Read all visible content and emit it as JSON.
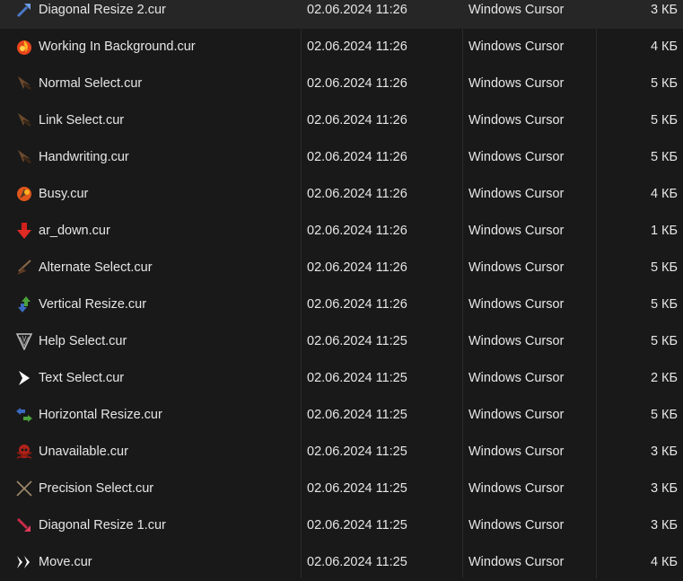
{
  "files": [
    {
      "name": "Diagonal Resize 2.cur",
      "date": "02.06.2024 11:26",
      "type": "Windows Cursor",
      "size": "3 КБ",
      "icon": "diagonal-resize-2-icon"
    },
    {
      "name": "Working In Background.cur",
      "date": "02.06.2024 11:26",
      "type": "Windows Cursor",
      "size": "4 КБ",
      "icon": "working-in-background-icon"
    },
    {
      "name": "Normal Select.cur",
      "date": "02.06.2024 11:26",
      "type": "Windows Cursor",
      "size": "5 КБ",
      "icon": "normal-select-icon"
    },
    {
      "name": "Link Select.cur",
      "date": "02.06.2024 11:26",
      "type": "Windows Cursor",
      "size": "5 КБ",
      "icon": "link-select-icon"
    },
    {
      "name": "Handwriting.cur",
      "date": "02.06.2024 11:26",
      "type": "Windows Cursor",
      "size": "5 КБ",
      "icon": "handwriting-icon"
    },
    {
      "name": "Busy.cur",
      "date": "02.06.2024 11:26",
      "type": "Windows Cursor",
      "size": "4 КБ",
      "icon": "busy-icon"
    },
    {
      "name": "ar_down.cur",
      "date": "02.06.2024 11:26",
      "type": "Windows Cursor",
      "size": "1 КБ",
      "icon": "arrow-down-icon"
    },
    {
      "name": "Alternate Select.cur",
      "date": "02.06.2024 11:26",
      "type": "Windows Cursor",
      "size": "5 КБ",
      "icon": "alternate-select-icon"
    },
    {
      "name": "Vertical Resize.cur",
      "date": "02.06.2024 11:26",
      "type": "Windows Cursor",
      "size": "5 КБ",
      "icon": "vertical-resize-icon"
    },
    {
      "name": "Help Select.cur",
      "date": "02.06.2024 11:25",
      "type": "Windows Cursor",
      "size": "5 КБ",
      "icon": "help-select-icon"
    },
    {
      "name": "Text Select.cur",
      "date": "02.06.2024 11:25",
      "type": "Windows Cursor",
      "size": "2 КБ",
      "icon": "text-select-icon"
    },
    {
      "name": "Horizontal Resize.cur",
      "date": "02.06.2024 11:25",
      "type": "Windows Cursor",
      "size": "5 КБ",
      "icon": "horizontal-resize-icon"
    },
    {
      "name": "Unavailable.cur",
      "date": "02.06.2024 11:25",
      "type": "Windows Cursor",
      "size": "3 КБ",
      "icon": "unavailable-icon"
    },
    {
      "name": "Precision Select.cur",
      "date": "02.06.2024 11:25",
      "type": "Windows Cursor",
      "size": "3 КБ",
      "icon": "precision-select-icon"
    },
    {
      "name": "Diagonal Resize 1.cur",
      "date": "02.06.2024 11:25",
      "type": "Windows Cursor",
      "size": "3 КБ",
      "icon": "diagonal-resize-1-icon"
    },
    {
      "name": "Move.cur",
      "date": "02.06.2024 11:25",
      "type": "Windows Cursor",
      "size": "4 КБ",
      "icon": "move-icon"
    }
  ],
  "colors": {
    "background": "#191919",
    "text": "#e6e6e6",
    "column_separator": "#2b2b2b"
  }
}
